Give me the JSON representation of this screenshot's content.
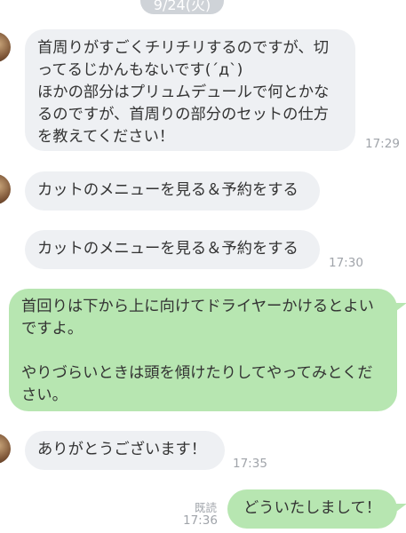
{
  "date_label": "9/24(火)",
  "messages": [
    {
      "side": "in",
      "text": "首周りがすごくチリチリするのですが、切ってるじかんもないです(´д`)\nほかの部分はプリュムデュールで何とかなるのですが、首周りの部分のセットの仕方を教えてください！",
      "time": "17:29"
    },
    {
      "side": "in",
      "text": "カットのメニューを見る＆予約をする",
      "time": ""
    },
    {
      "side": "in",
      "text": "カットのメニューを見る＆予約をする",
      "time": "17:30"
    },
    {
      "side": "out",
      "text": "首回りは下から上に向けてドライヤーかけるとよいですよ。\n\nやりづらいときは頭を傾けたりしてやってみとください。",
      "time": ""
    },
    {
      "side": "in",
      "text": "ありがとうございます！",
      "time": "17:35"
    },
    {
      "side": "out",
      "text": "どういたしまして！",
      "time": "17:36",
      "read": "既読"
    }
  ]
}
